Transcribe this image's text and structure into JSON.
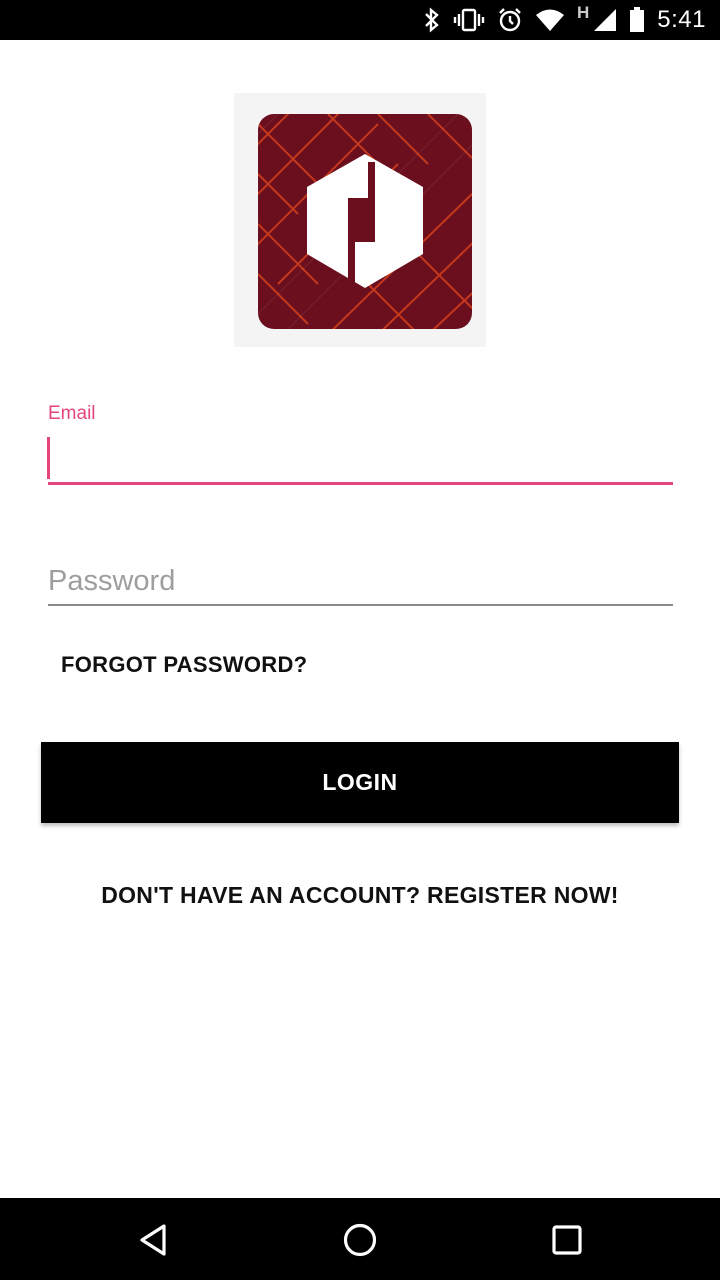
{
  "status_bar": {
    "network_type": "H",
    "time": "5:41"
  },
  "form": {
    "email_label": "Email",
    "email_value": "",
    "password_placeholder": "Password",
    "password_value": "",
    "forgot_password_label": "FORGOT PASSWORD?",
    "login_label": "LOGIN",
    "register_label": "DON'T HAVE AN ACCOUNT? REGISTER NOW!"
  },
  "colors": {
    "accent": "#e5457f",
    "logo_background": "#6b0f1f",
    "logo_lines": "#d4401f",
    "button": "#000000"
  },
  "icons": {
    "status": [
      "bluetooth-icon",
      "vibrate-icon",
      "alarm-icon",
      "wifi-icon",
      "cell-signal-icon",
      "battery-icon"
    ],
    "navigation": [
      "back-icon",
      "home-icon",
      "recents-icon"
    ]
  }
}
